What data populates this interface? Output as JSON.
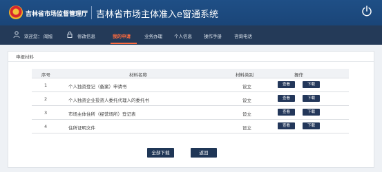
{
  "header": {
    "org_name": "吉林省市场监督管理厅",
    "app_title": "吉林省市场主体准入e窗通系统",
    "emblem_icon": "emblem-icon",
    "power_icon": "power-icon"
  },
  "nav": {
    "welcome": "欢迎您：",
    "username": "阎旭",
    "items": [
      "修改信息",
      "我的申请",
      "业务办理",
      "个人信息",
      "操作手册",
      "咨询电话"
    ],
    "active": "我的申请",
    "active_color": "#ff6a3d"
  },
  "panel": {
    "title": "申报材料"
  },
  "table": {
    "headers": [
      "序号",
      "材料名称",
      "材料类别",
      "操作"
    ],
    "rows": [
      {
        "no": "1",
        "name": "个人独资登记（备案）申请书",
        "type": "设立",
        "view": "查看",
        "download": "下载"
      },
      {
        "no": "2",
        "name": "个人独资企业投资人委托代理人的委托书",
        "type": "设立",
        "view": "查看",
        "download": "下载"
      },
      {
        "no": "3",
        "name": "市场主体住所（经营场所）登记表",
        "type": "设立",
        "view": "查看",
        "download": "下载"
      },
      {
        "no": "4",
        "name": "住所证明文件",
        "type": "设立",
        "view": "查看",
        "download": "下载"
      }
    ]
  },
  "actions": {
    "download_all": "全部下载",
    "back": "返回"
  }
}
